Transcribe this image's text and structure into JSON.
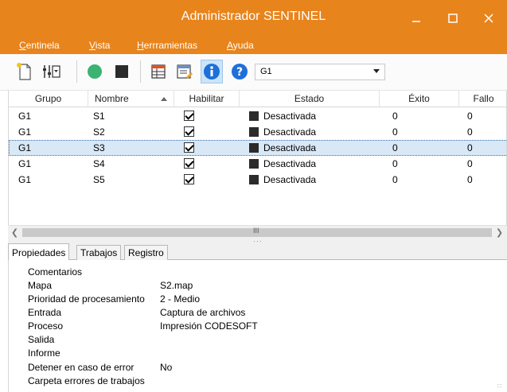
{
  "window": {
    "title": "Administrador SENTINEL"
  },
  "menubar": {
    "items": [
      {
        "label": "Centinela"
      },
      {
        "label": "Vista"
      },
      {
        "label": "Herrramientas"
      },
      {
        "label": "Ayuda"
      }
    ]
  },
  "toolbar": {
    "icons": [
      "new-document-icon",
      "sliders-icon",
      "start-icon",
      "stop-icon",
      "table-icon",
      "properties-icon",
      "info-icon",
      "help-icon"
    ],
    "group_combo": {
      "value": "G1"
    }
  },
  "grid": {
    "columns": [
      "Grupo",
      "Nombre",
      "Habilitar",
      "Estado",
      "Éxito",
      "Fallo"
    ],
    "sorted_column": "Nombre",
    "rows": [
      {
        "grupo": "G1",
        "nombre": "S1",
        "habilitar": true,
        "estado": "Desactivada",
        "exito": "0",
        "fallo": "0"
      },
      {
        "grupo": "G1",
        "nombre": "S2",
        "habilitar": true,
        "estado": "Desactivada",
        "exito": "0",
        "fallo": "0"
      },
      {
        "grupo": "G1",
        "nombre": "S3",
        "habilitar": true,
        "estado": "Desactivada",
        "exito": "0",
        "fallo": "0"
      },
      {
        "grupo": "G1",
        "nombre": "S4",
        "habilitar": true,
        "estado": "Desactivada",
        "exito": "0",
        "fallo": "0"
      },
      {
        "grupo": "G1",
        "nombre": "S5",
        "habilitar": true,
        "estado": "Desactivada",
        "exito": "0",
        "fallo": "0"
      }
    ],
    "selected_row": 2,
    "scroll_thumb_glyph": "III"
  },
  "tabs": [
    {
      "label": "Propiedades",
      "active": true
    },
    {
      "label": "Trabajos",
      "active": false
    },
    {
      "label": "Registro",
      "active": false
    }
  ],
  "properties": [
    {
      "label": "Comentarios",
      "value": ""
    },
    {
      "label": "Mapa",
      "value": "S2.map"
    },
    {
      "label": "Prioridad de procesamiento",
      "value": "2 - Medio"
    },
    {
      "label": "Entrada",
      "value": "Captura de archivos"
    },
    {
      "label": "Proceso",
      "value": "Impresión CODESOFT"
    },
    {
      "label": "Salida",
      "value": ""
    },
    {
      "label": "Informe",
      "value": ""
    },
    {
      "label": "Detener en caso de error",
      "value": "No"
    },
    {
      "label": "Carpeta errores de trabajos",
      "value": ""
    }
  ],
  "colors": {
    "titlebar": "#e8841c",
    "selection": "#d9e8f6",
    "start_green": "#3cb371",
    "info_blue": "#1e6fd9"
  }
}
